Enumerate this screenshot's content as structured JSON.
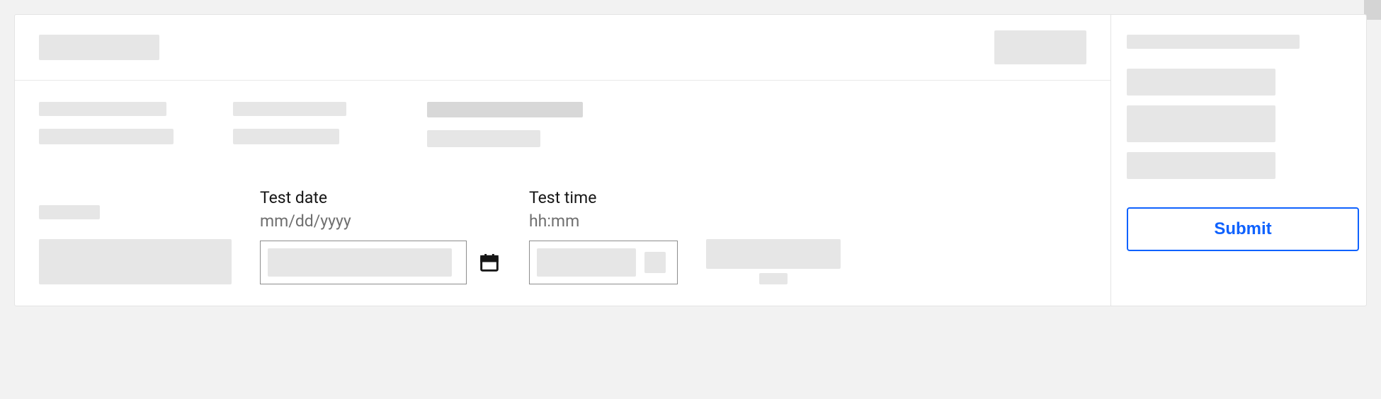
{
  "form": {
    "test_date": {
      "label": "Test date",
      "hint": "mm/dd/yyyy"
    },
    "test_time": {
      "label": "Test time",
      "hint": "hh:mm"
    }
  },
  "actions": {
    "submit_label": "Submit"
  }
}
